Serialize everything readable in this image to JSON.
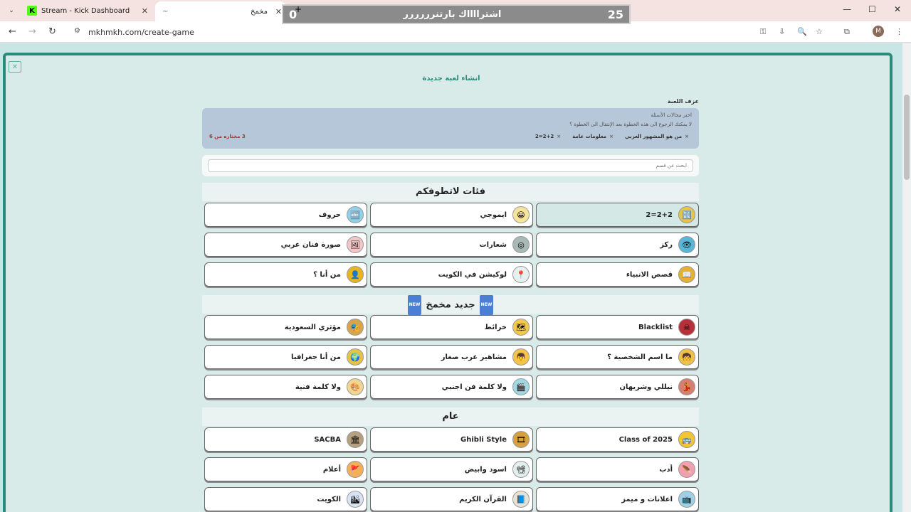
{
  "browser": {
    "tabs": [
      {
        "title": "Stream - Kick Dashboard",
        "favicon": "K"
      },
      {
        "title": "مخمخ",
        "favicon": "~"
      }
    ],
    "url": "mkhmkh.com/create-game",
    "avatar_letter": "M"
  },
  "overlay": {
    "left_num": "0",
    "text": "اشترااااك بارتنرررررر",
    "right_num": "25"
  },
  "page": {
    "title": "انشاء لعبة جديدة",
    "game_name_label": "عزف اللعبة",
    "selection": {
      "line1": "اختر مجالات الأسئلة",
      "line2": "لا يمكنك الرجوع الى هذه الخطوة بعد الإنتقال الى الخطوة ؟",
      "chips": [
        "من هو المشهور العربي",
        "معلومات عامة",
        "2+2=2"
      ],
      "count": "3 مختاره من 6"
    },
    "search_placeholder": "ابحث عن قسم",
    "sections": [
      {
        "title": "فئات لاتطوفكم",
        "cards": [
          {
            "label": "2+2=2",
            "icon": "🔣",
            "color": "#e8c44a",
            "selected": true
          },
          {
            "label": "ايموجي",
            "icon": "😀",
            "color": "#f5e49a"
          },
          {
            "label": "حروف",
            "icon": "🔤",
            "color": "#8fd1ea"
          },
          {
            "label": "ركز",
            "icon": "👁",
            "color": "#59b6d6"
          },
          {
            "label": "شعارات",
            "icon": "◎",
            "color": "#a9b9b6"
          },
          {
            "label": "صورة فنان عربي",
            "icon": "🖼",
            "color": "#f3c6c6"
          },
          {
            "label": "قصص الانبياء",
            "icon": "📖",
            "color": "#e3b233"
          },
          {
            "label": "لوكيشن في الكويت",
            "icon": "📍",
            "color": "#e6f0ee"
          },
          {
            "label": "من أنا ؟",
            "icon": "👤",
            "color": "#e8b51f"
          }
        ]
      },
      {
        "title": "جديد مخمخ",
        "badge": "NEW",
        "cards": [
          {
            "label": "Blacklist",
            "icon": "☠",
            "color": "#b7303a"
          },
          {
            "label": "خرائط",
            "icon": "🗺",
            "color": "#f2c94c"
          },
          {
            "label": "مؤثري السعودية",
            "icon": "🎭",
            "color": "#d8a648"
          },
          {
            "label": "ما اسم الشخصية ؟",
            "icon": "🧒",
            "color": "#f0c048"
          },
          {
            "label": "مشاهير عرب صغار",
            "icon": "👦",
            "color": "#f3c34a"
          },
          {
            "label": "من أنا جغرافيا",
            "icon": "🌍",
            "color": "#e6c246"
          },
          {
            "label": "نيللي وشريهان",
            "icon": "💃",
            "color": "#d77f6e"
          },
          {
            "label": "ولا كلمة فن اجنبي",
            "icon": "🎬",
            "color": "#9fdbe6"
          },
          {
            "label": "ولا كلمة فنية",
            "icon": "🎨",
            "color": "#f0d690"
          }
        ]
      },
      {
        "title": "عام",
        "cards": [
          {
            "label": "Class of 2025",
            "icon": "🚌",
            "color": "#f2c531"
          },
          {
            "label": "Ghibli Style",
            "icon": "🎞",
            "color": "#d9a040"
          },
          {
            "label": "SACBA",
            "icon": "🏛",
            "color": "#b5a080"
          },
          {
            "label": "أدب",
            "icon": "🪶",
            "color": "#f2a0b0"
          },
          {
            "label": "اسود وابيض",
            "icon": "📽",
            "color": "#e3efed"
          },
          {
            "label": "أعلام",
            "icon": "🚩",
            "color": "#f3b058"
          },
          {
            "label": "اعلانات و ميمز",
            "icon": "📺",
            "color": "#9fd1e6"
          },
          {
            "label": "القرآن الكريم",
            "icon": "📘",
            "color": "#e7e2d6"
          },
          {
            "label": "الكويت",
            "icon": "🏙",
            "color": "#d7e3f3"
          }
        ]
      }
    ]
  }
}
